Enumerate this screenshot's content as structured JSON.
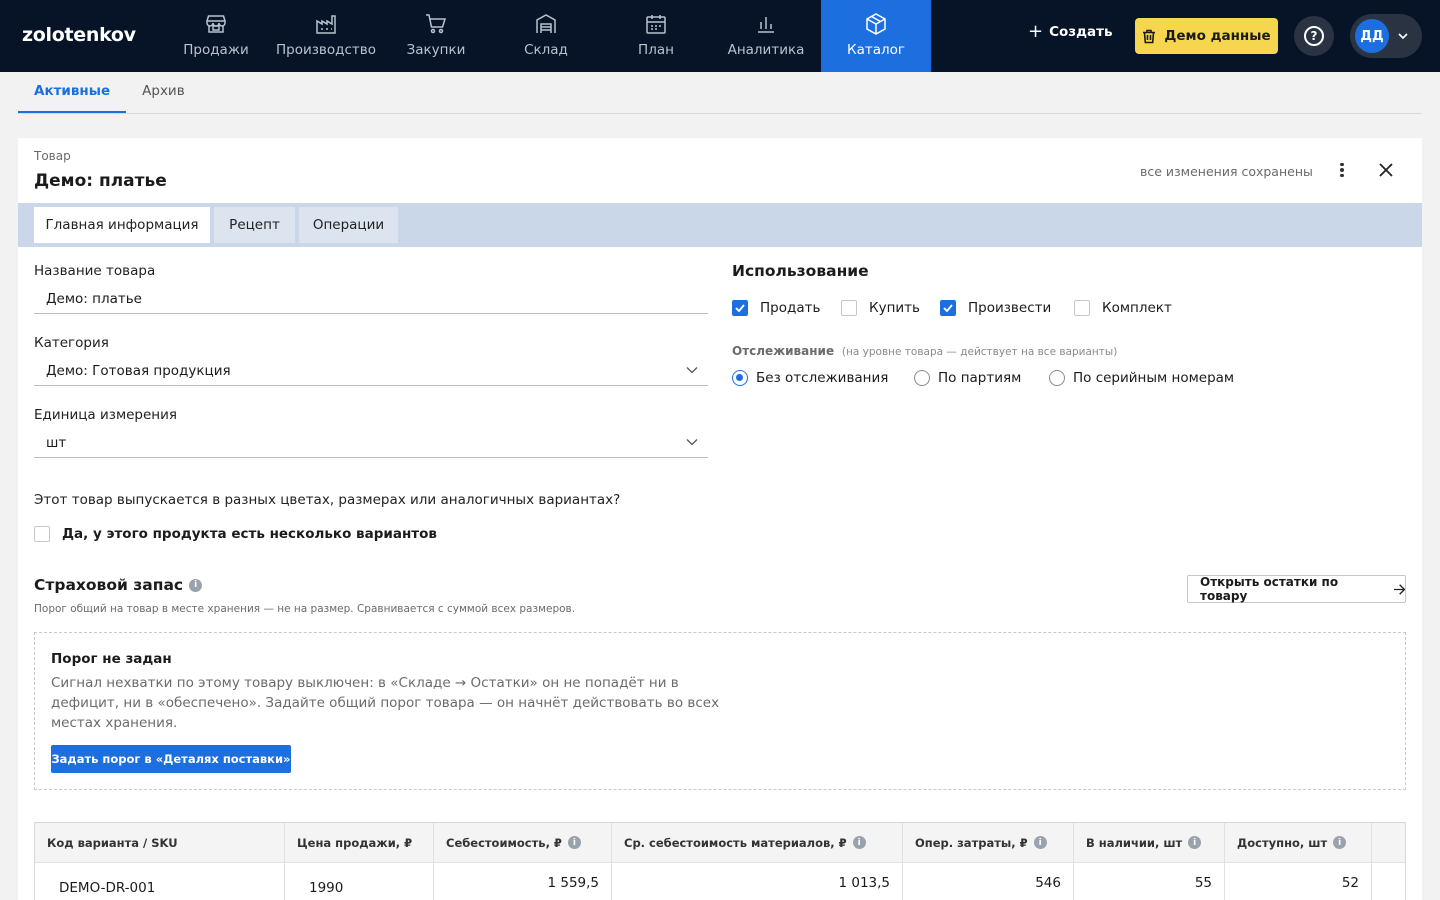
{
  "app": {
    "logo": "zolotenkov"
  },
  "nav": [
    {
      "label": "Продажи",
      "icon": "store-icon"
    },
    {
      "label": "Производство",
      "icon": "factory-icon"
    },
    {
      "label": "Закупки",
      "icon": "cart-icon"
    },
    {
      "label": "Склад",
      "icon": "warehouse-icon"
    },
    {
      "label": "План",
      "icon": "calendar-icon"
    },
    {
      "label": "Аналитика",
      "icon": "bar-chart-icon"
    },
    {
      "label": "Каталог",
      "icon": "box-icon",
      "active": true
    }
  ],
  "header": {
    "create_label": "Создать",
    "demo_label": "Демо данные",
    "help_glyph": "?",
    "avatar_initials": "ДД"
  },
  "subtabs": [
    {
      "label": "Активные",
      "active": true
    },
    {
      "label": "Архив"
    }
  ],
  "product": {
    "breadcrumb": "Товар",
    "title": "Демо: платье",
    "saved_status": "все изменения сохранены"
  },
  "tabs": [
    {
      "label": "Главная информация",
      "active": true
    },
    {
      "label": "Рецепт"
    },
    {
      "label": "Операции"
    }
  ],
  "form": {
    "name_label": "Название товара",
    "name_value": "Демо: платье",
    "category_label": "Категория",
    "category_value": "Демо: Готовая продукция",
    "unit_label": "Единица измерения",
    "unit_value": "шт",
    "variants_question": "Этот товар выпускается в разных цветах, размерах или аналогичных вариантах?",
    "variants_checkbox": "Да, у этого продукта есть несколько вариантов",
    "variants_checked": false
  },
  "usage": {
    "title": "Использование",
    "options": [
      {
        "label": "Продать",
        "checked": true
      },
      {
        "label": "Купить",
        "checked": false
      },
      {
        "label": "Произвести",
        "checked": true
      },
      {
        "label": "Комплект",
        "checked": false
      }
    ],
    "tracking_label": "Отслеживание",
    "tracking_note": "(на уровне товара — действует на все варианты)",
    "tracking_options": [
      {
        "label": "Без отслеживания",
        "selected": true
      },
      {
        "label": "По партиям",
        "selected": false
      },
      {
        "label": "По серийным номерам",
        "selected": false
      }
    ]
  },
  "safety_stock": {
    "title": "Страховой запас",
    "subtitle": "Порог общий на товар в месте хранения — не на размер. Сравнивается с суммой всех размеров.",
    "open_button": "Открыть остатки по товару",
    "empty_title": "Порог не задан",
    "empty_text": "Сигнал нехватки по этому товару выключен: в «Складе → Остатки» он не попадёт ни в дефицит, ни в «обеспечено». Задайте общий порог товара — он начнёт действовать во всех местах хранения.",
    "empty_button": "Задать порог в «Деталях поставки»"
  },
  "variants_table": {
    "columns": [
      {
        "label": "Код варианта / SKU",
        "info": false
      },
      {
        "label": "Цена продажи, ₽",
        "info": false
      },
      {
        "label": "Себестоимость, ₽",
        "info": true
      },
      {
        "label": "Ср. себестоимость материалов, ₽",
        "info": true
      },
      {
        "label": "Опер. затраты, ₽",
        "info": true
      },
      {
        "label": "В наличии, шт",
        "info": true
      },
      {
        "label": "Доступно, шт",
        "info": true
      },
      {
        "label": "",
        "info": false
      }
    ],
    "rows": [
      [
        "DEMO-DR-001",
        "1990",
        "1 559,5",
        "1 013,5",
        "546",
        "55",
        "52",
        ""
      ]
    ]
  },
  "colors": {
    "accent": "#1d6fe0",
    "topbar": "#071427",
    "demo": "#f5d64e"
  }
}
